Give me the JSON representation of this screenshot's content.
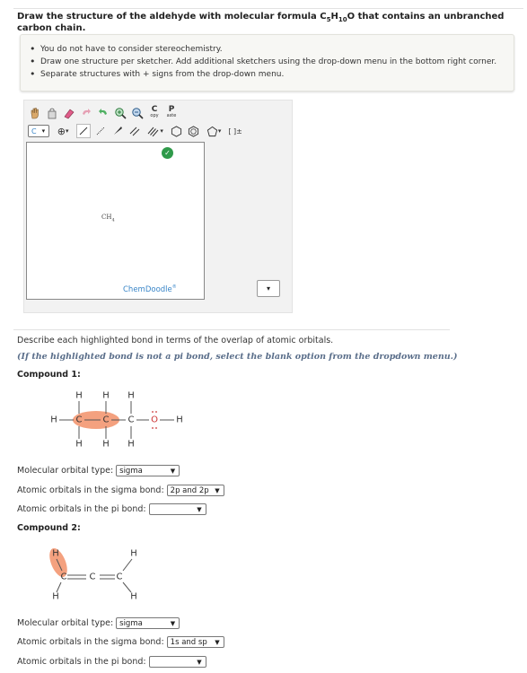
{
  "question": {
    "title_prefix": "Draw the structure of the aldehyde with molecular formula C",
    "c_sub": "5",
    "h_label": "H",
    "h_sub": "10",
    "title_suffix": "O that contains an unbranched carbon chain."
  },
  "notes": [
    "You do not have to consider stereochemistry.",
    "Draw one structure per sketcher. Add additional sketchers using the drop-down menu in the bottom right corner.",
    "Separate structures with + signs from the drop-down menu."
  ],
  "sketcher": {
    "element_selector": "C",
    "copy_label_top": "C",
    "copy_label_bottom": "opy",
    "paste_label_top": "P",
    "paste_label_bottom": "aste",
    "canvas_text": "CH",
    "canvas_text_sub": "4",
    "brand": "ChemDoodle",
    "brand_mark": "®",
    "charge_label": "[ ]±"
  },
  "section": {
    "describe": "Describe each highlighted bond in terms of the overlap of atomic orbitals.",
    "hint": "(If the highlighted bond is not a pi bond, select the blank option from the dropdown menu.)"
  },
  "compound1": {
    "label": "Compound 1:",
    "fields": [
      {
        "label": "Molecular orbital type:",
        "value": "sigma"
      },
      {
        "label": "Atomic orbitals in the sigma bond:",
        "value": "2p and 2p"
      },
      {
        "label": "Atomic orbitals in the pi bond:",
        "value": ""
      }
    ]
  },
  "compound2": {
    "label": "Compound 2:",
    "fields": [
      {
        "label": "Molecular orbital type:",
        "value": "sigma"
      },
      {
        "label": "Atomic orbitals in the sigma bond:",
        "value": "1s and sp"
      },
      {
        "label": "Atomic orbitals in the pi bond:",
        "value": ""
      }
    ]
  },
  "atoms": {
    "H": "H",
    "C": "C",
    "O": "O"
  },
  "colors": {
    "highlight": "#f4a17f",
    "accent": "#3a86c8",
    "check": "#2f9a4a"
  }
}
